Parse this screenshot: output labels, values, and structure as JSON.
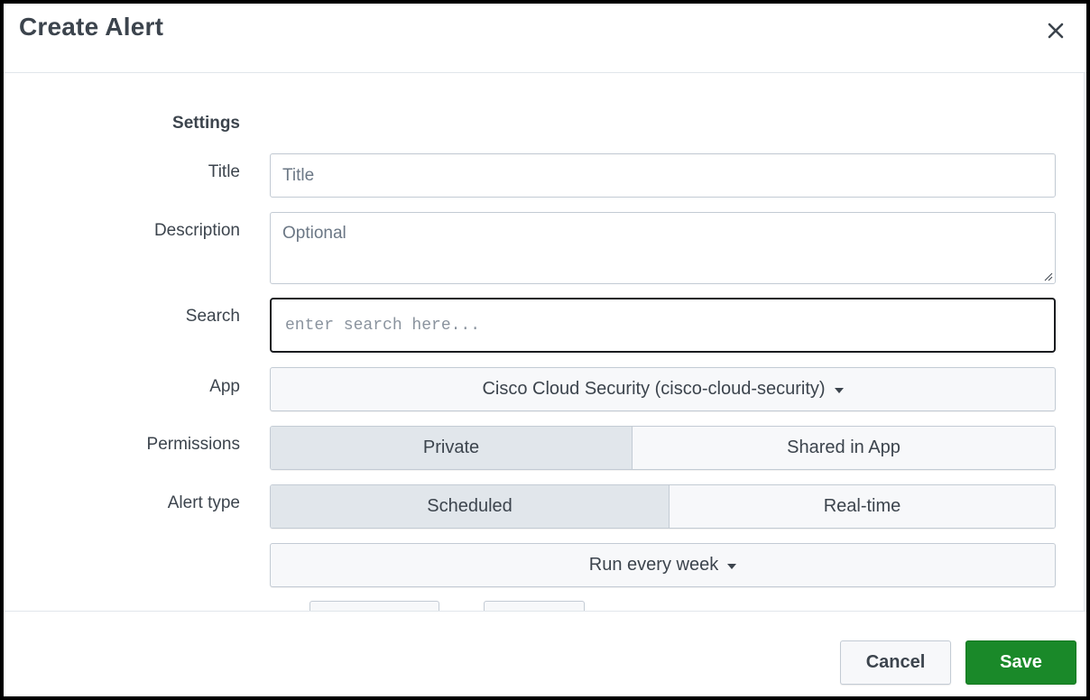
{
  "dialog": {
    "title": "Create Alert",
    "close_icon": "close-icon"
  },
  "form": {
    "section_title": "Settings",
    "title": {
      "label": "Title",
      "placeholder": "Title",
      "value": ""
    },
    "description": {
      "label": "Description",
      "placeholder": "Optional",
      "value": ""
    },
    "search": {
      "label": "Search",
      "placeholder": "enter search here...",
      "value": ""
    },
    "app": {
      "label": "App",
      "selected": "Cisco Cloud Security (cisco-cloud-security)"
    },
    "permissions": {
      "label": "Permissions",
      "options": [
        "Private",
        "Shared in App"
      ],
      "selected": "Private"
    },
    "alert_type": {
      "label": "Alert type",
      "options": [
        "Scheduled",
        "Real-time"
      ],
      "selected": "Scheduled"
    },
    "schedule": {
      "selected": "Run every week"
    }
  },
  "footer": {
    "cancel_label": "Cancel",
    "save_label": "Save"
  },
  "colors": {
    "save": "#1a8929",
    "text": "#3c444d",
    "border": "#c3cbd4",
    "active_segment": "#e1e6eb"
  }
}
